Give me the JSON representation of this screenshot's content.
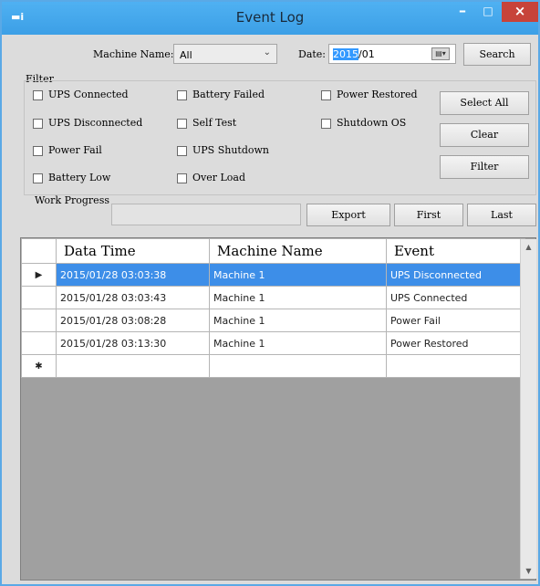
{
  "window": {
    "title": "Event Log",
    "app_icon": "▬i",
    "minimize": "–",
    "maximize": "□",
    "close": "×"
  },
  "top": {
    "machine_label": "Machine Name:",
    "machine_value": "All",
    "date_label": "Date:",
    "date_selected": "2015",
    "date_rest": "/01",
    "search_label": "Search"
  },
  "filter": {
    "title": "Filter",
    "checkboxes": [
      "UPS Connected",
      "UPS Disconnected",
      "Power Fail",
      "Battery Low",
      "Battery Failed",
      "Self Test",
      "UPS Shutdown",
      "Over Load",
      "Power Restored",
      "Shutdown OS"
    ],
    "select_all_label": "Select All",
    "clear_label": "Clear",
    "filter_label": "Filter"
  },
  "progress": {
    "label": "Work Progress",
    "value": 0
  },
  "actions": {
    "export_label": "Export",
    "first_label": "First",
    "last_label": "Last"
  },
  "grid": {
    "columns": [
      "Data Time",
      "Machine Name",
      "Event"
    ],
    "rows": [
      {
        "marker": "▶",
        "cells": [
          "2015/01/28 03:03:38",
          "Machine 1",
          "UPS Disconnected"
        ],
        "selected": true
      },
      {
        "marker": "",
        "cells": [
          "2015/01/28 03:03:43",
          "Machine 1",
          "UPS Connected"
        ],
        "selected": false
      },
      {
        "marker": "",
        "cells": [
          "2015/01/28 03:08:28",
          "Machine 1",
          "Power Fail"
        ],
        "selected": false
      },
      {
        "marker": "",
        "cells": [
          "2015/01/28 03:13:30",
          "Machine 1",
          "Power Restored"
        ],
        "selected": false
      },
      {
        "marker": "✱",
        "cells": [
          "",
          "",
          ""
        ],
        "selected": false
      }
    ]
  },
  "colors": {
    "titlebar": "#3c9fe6",
    "close_button": "#c7433a",
    "selection": "#3d8ee8",
    "grid_background": "#a0a0a0"
  }
}
